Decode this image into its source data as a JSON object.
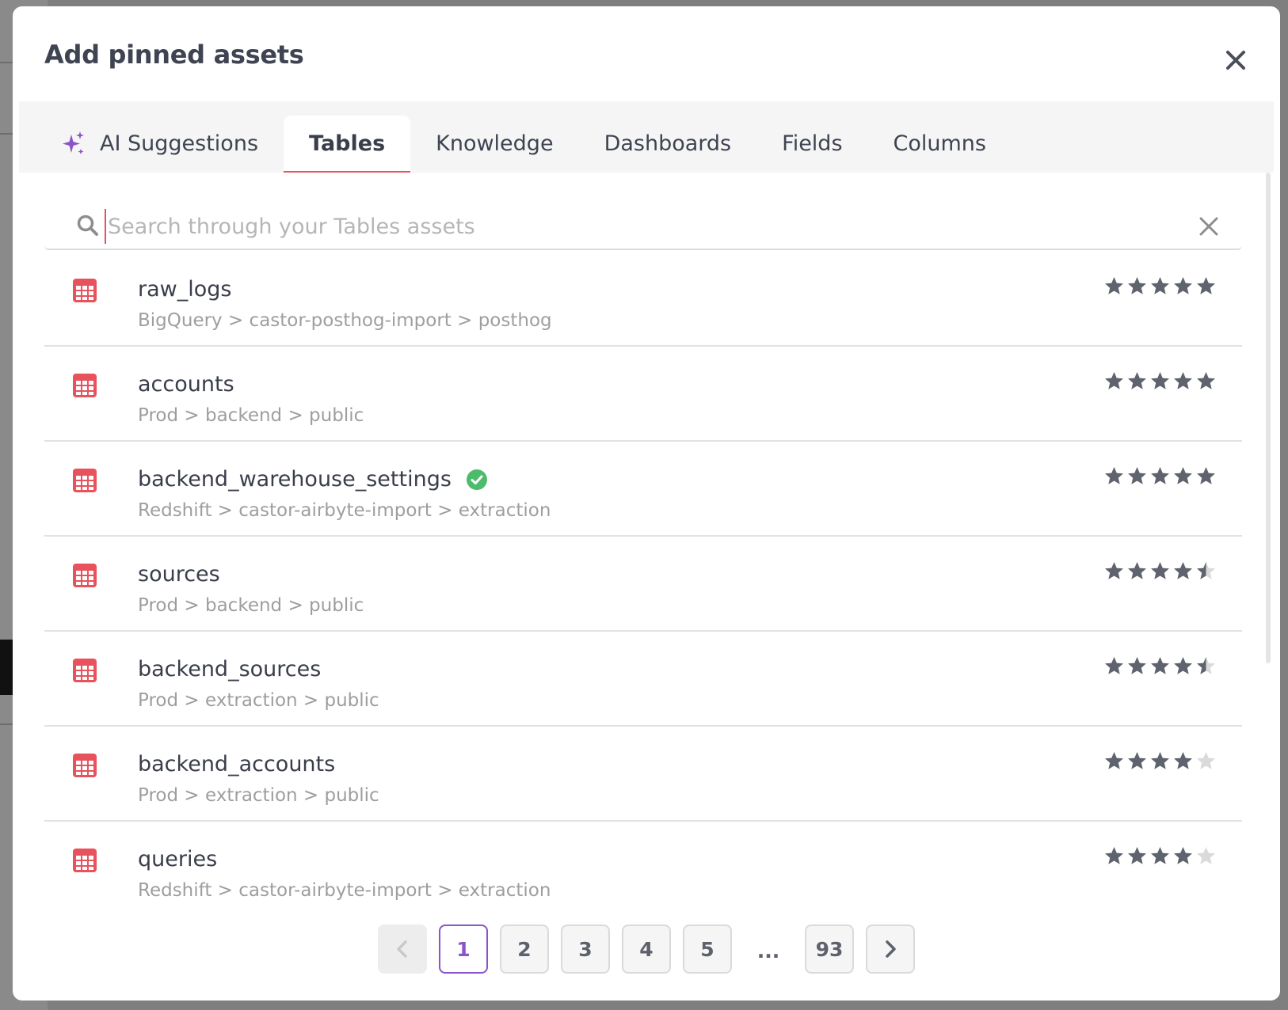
{
  "modal": {
    "title": "Add pinned assets"
  },
  "tabs": [
    {
      "label": "AI Suggestions",
      "icon": "sparkles-icon",
      "active": false
    },
    {
      "label": "Tables",
      "active": true
    },
    {
      "label": "Knowledge",
      "active": false
    },
    {
      "label": "Dashboards",
      "active": false
    },
    {
      "label": "Fields",
      "active": false
    },
    {
      "label": "Columns",
      "active": false
    }
  ],
  "search": {
    "placeholder": "Search through your Tables assets",
    "value": ""
  },
  "rows": [
    {
      "name": "raw_logs",
      "path": "BigQuery > castor-posthog-import > posthog",
      "rating": 5,
      "verified": false
    },
    {
      "name": "accounts",
      "path": "Prod > backend > public",
      "rating": 5,
      "verified": false
    },
    {
      "name": "backend_warehouse_settings",
      "path": "Redshift > castor-airbyte-import > extraction",
      "rating": 5,
      "verified": true
    },
    {
      "name": "sources",
      "path": "Prod > backend > public",
      "rating": 4.5,
      "verified": false
    },
    {
      "name": "backend_sources",
      "path": "Prod > extraction > public",
      "rating": 4.5,
      "verified": false
    },
    {
      "name": "backend_accounts",
      "path": "Prod > extraction > public",
      "rating": 4,
      "verified": false
    },
    {
      "name": "queries",
      "path": "Redshift > castor-airbyte-import > extraction",
      "rating": 4,
      "verified": false
    }
  ],
  "pagination": {
    "pages": [
      "1",
      "2",
      "3",
      "4",
      "5"
    ],
    "ellipsis": "...",
    "last": "93",
    "current": "1"
  },
  "colors": {
    "accent": "#e8525c",
    "active_page": "#8b54c9",
    "star_filled": "#5f636e",
    "star_empty": "#dadada",
    "verified": "#4cbb6b",
    "sparkle": "#8b54c9"
  }
}
